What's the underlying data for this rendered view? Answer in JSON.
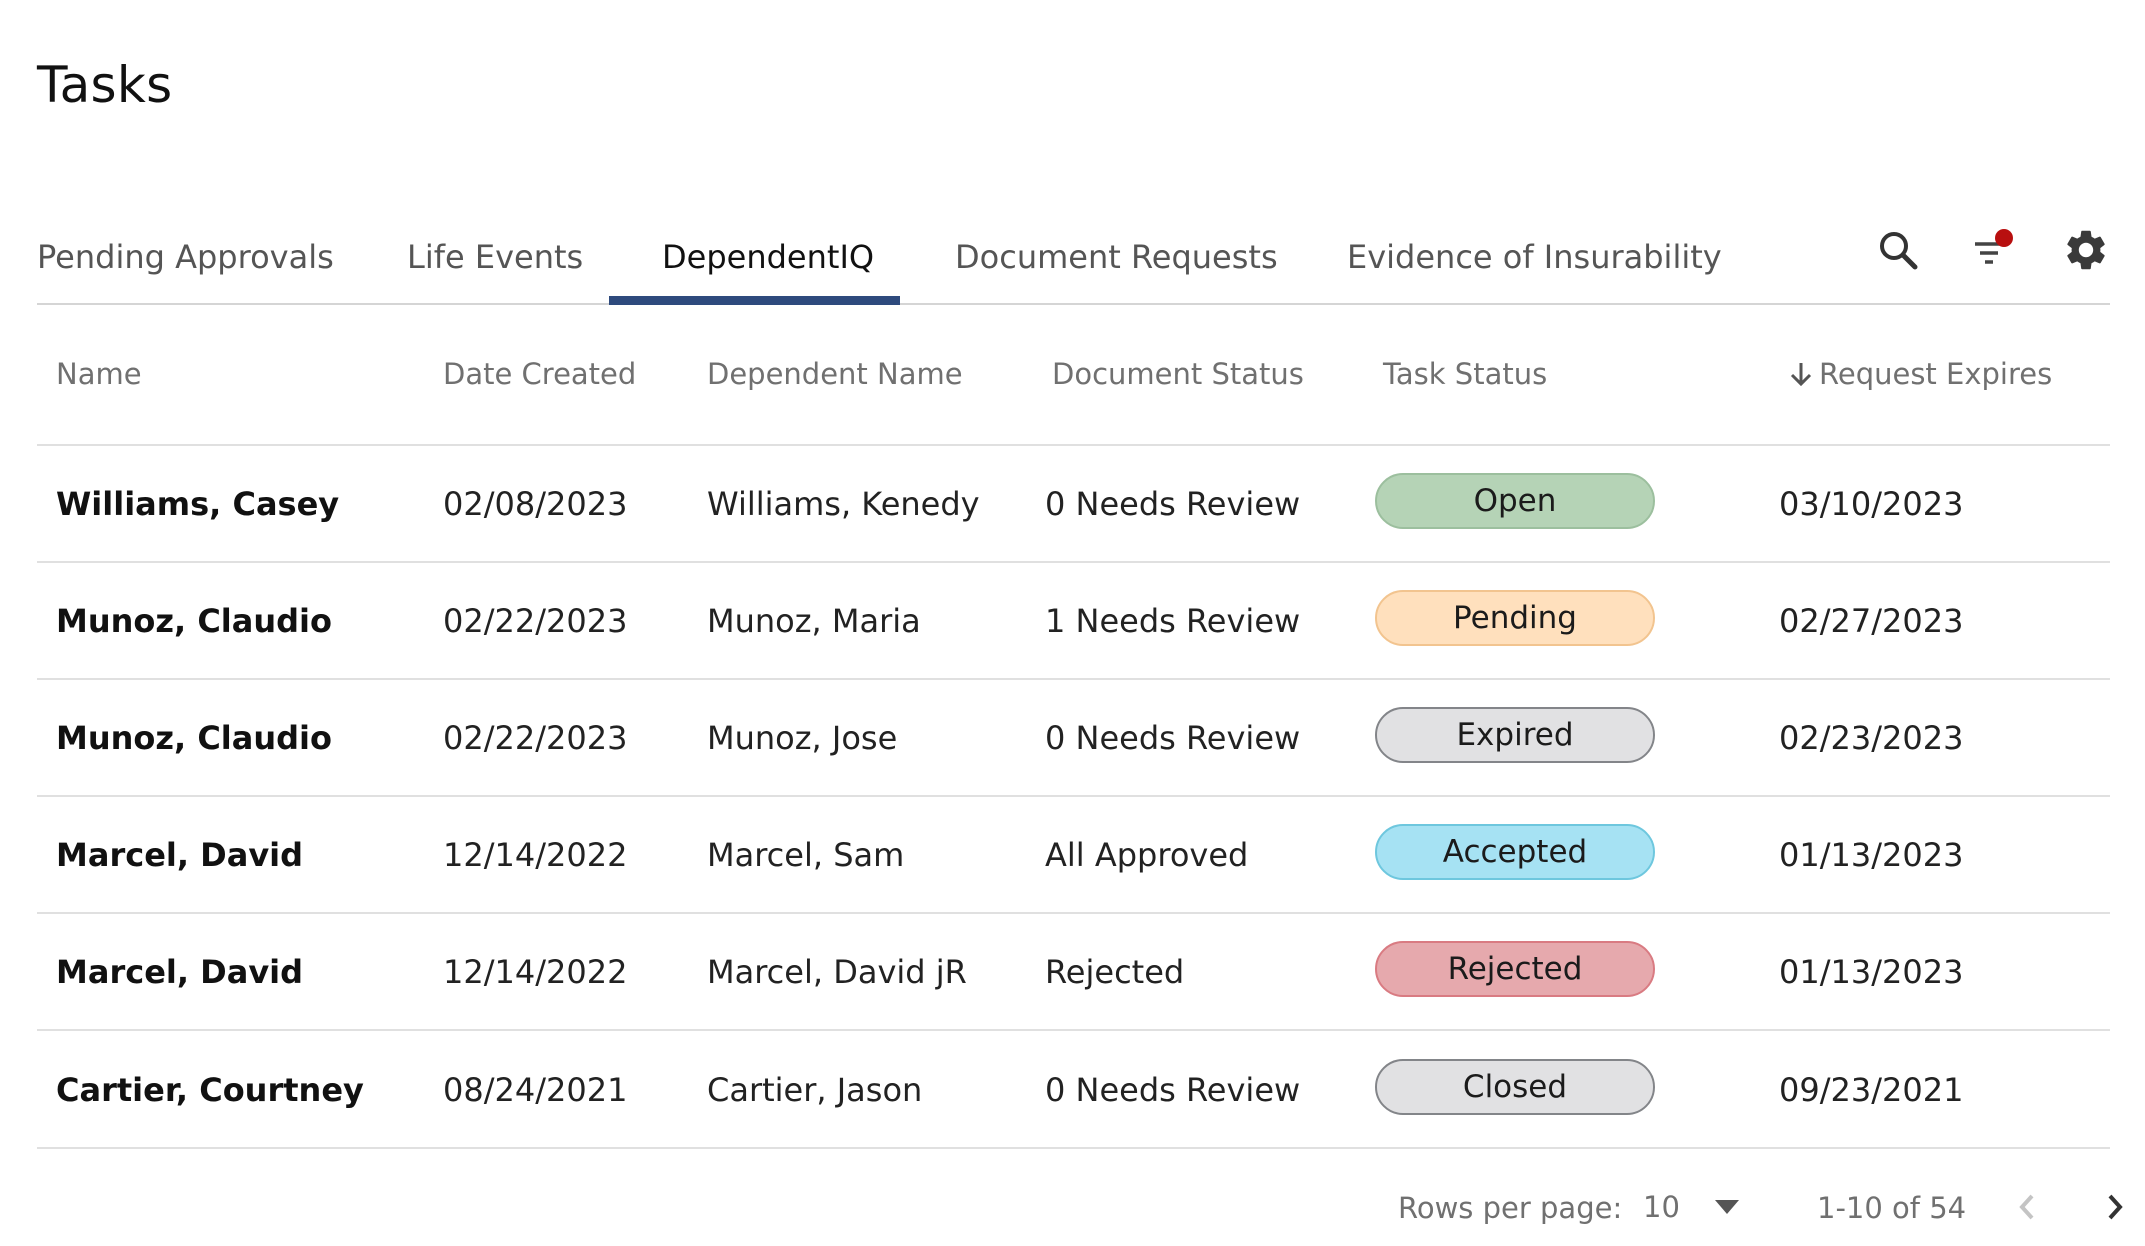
{
  "page": {
    "title": "Tasks"
  },
  "tabs": [
    {
      "label": "Pending Approvals"
    },
    {
      "label": "Life Events"
    },
    {
      "label": "DependentIQ"
    },
    {
      "label": "Document Requests"
    },
    {
      "label": "Evidence of Insurability"
    }
  ],
  "active_tab": "DependentIQ",
  "toolbar": {
    "icons": [
      "search-icon",
      "filter-icon",
      "gear-icon"
    ],
    "filter_badge_color": "#b80f0f"
  },
  "table": {
    "columns": [
      "Name",
      "Date Created",
      "Dependent Name",
      "Document Status",
      "Task Status",
      "Request Expires"
    ],
    "sort_column": "Request Expires",
    "sort_direction": "descending",
    "rows": [
      {
        "name": "Williams, Casey",
        "date_created": "02/08/2023",
        "dependent": "Williams, Kenedy",
        "doc_status": "0 Needs Review",
        "task_status": "Open",
        "expires": "03/10/2023"
      },
      {
        "name": "Munoz, Claudio",
        "date_created": "02/22/2023",
        "dependent": "Munoz, Maria",
        "doc_status": "1 Needs Review",
        "task_status": "Pending",
        "expires": "02/27/2023"
      },
      {
        "name": "Munoz, Claudio",
        "date_created": "02/22/2023",
        "dependent": "Munoz, Jose",
        "doc_status": "0 Needs Review",
        "task_status": "Expired",
        "expires": "02/23/2023"
      },
      {
        "name": "Marcel, David",
        "date_created": "12/14/2022",
        "dependent": "Marcel, Sam",
        "doc_status": "All Approved",
        "task_status": "Accepted",
        "expires": "01/13/2023"
      },
      {
        "name": "Marcel, David",
        "date_created": "12/14/2022",
        "dependent": "Marcel, David jR",
        "doc_status": "Rejected",
        "task_status": "Rejected",
        "expires": "01/13/2023"
      },
      {
        "name": "Cartier, Courtney",
        "date_created": "08/24/2021",
        "dependent": "Cartier, Jason",
        "doc_status": "0 Needs Review",
        "task_status": "Closed",
        "expires": "09/23/2021"
      }
    ]
  },
  "status_colors": {
    "Open": {
      "bg": "#b5d3b6",
      "border": "#9cbf9e"
    },
    "Pending": {
      "bg": "#ffe0bd",
      "border": "#f2c48f"
    },
    "Expired": {
      "bg": "#e1e1e3",
      "border": "#838589"
    },
    "Accepted": {
      "bg": "#a6e2f3",
      "border": "#6ec7de"
    },
    "Rejected": {
      "bg": "#e6a9ad",
      "border": "#d97b82"
    },
    "Closed": {
      "bg": "#e1e1e3",
      "border": "#838589"
    }
  },
  "pagination": {
    "rows_per_page_label": "Rows per page:",
    "rows_per_page": "10",
    "range": "1-10 of 54"
  },
  "colors": {
    "accent": "#2e4a7d"
  }
}
